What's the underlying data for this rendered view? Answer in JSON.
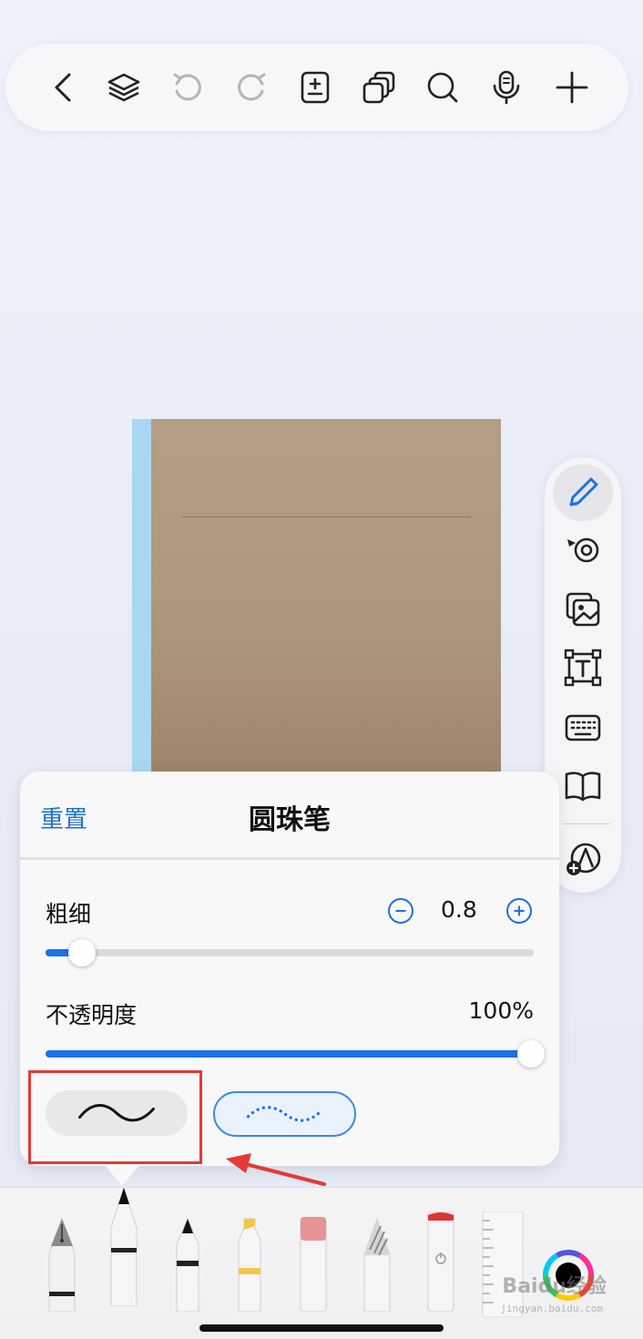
{
  "toolbar": {
    "buttons": [
      {
        "icon": "back-chevron-icon"
      },
      {
        "icon": "layers-icon"
      },
      {
        "icon": "undo-icon"
      },
      {
        "icon": "redo-icon"
      },
      {
        "icon": "page-add-icon"
      },
      {
        "icon": "copy-pages-icon"
      },
      {
        "icon": "search-icon"
      },
      {
        "icon": "microphone-icon"
      },
      {
        "icon": "plus-icon"
      }
    ]
  },
  "side_palette": {
    "tools": [
      "pencil-icon",
      "lasso-tape-icon",
      "image-icon",
      "text-box-icon",
      "keyboard-icon",
      "book-icon",
      "add-shapes-icon"
    ],
    "active": "pencil-icon"
  },
  "pen_settings": {
    "reset_label": "重置",
    "title": "圆珠笔",
    "thickness_label": "粗细",
    "thickness_value": "0.8",
    "thickness_fraction": 0.06,
    "opacity_label": "不透明度",
    "opacity_value": "100%",
    "opacity_fraction": 1.0,
    "stroke_styles": [
      "solid",
      "dotted"
    ],
    "selected_style": "solid"
  },
  "tray": {
    "tools": [
      "fountain-pen",
      "ballpoint-pen",
      "marker",
      "highlighter",
      "eraser",
      "pencil",
      "lasso",
      "ruler",
      "color-picker"
    ],
    "selected": "ballpoint-pen",
    "current_color": "#000000"
  },
  "watermark": {
    "text": "Baidu经验",
    "sub": "jingyan.baidu.com"
  },
  "colors": {
    "accent": "#1f6fd6",
    "annotation_red": "#e53935",
    "notebook_cover": "#b49f84",
    "notebook_spine": "#a9d7f2"
  }
}
